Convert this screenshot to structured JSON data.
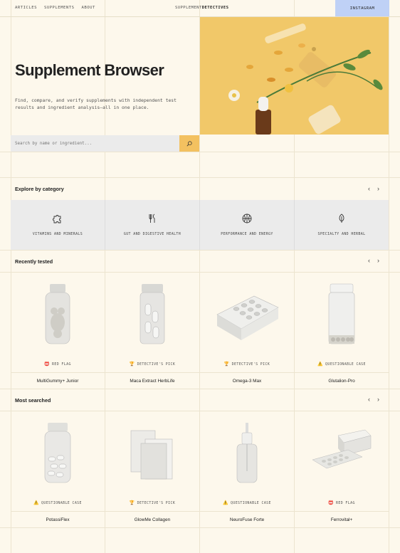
{
  "nav": {
    "links": [
      "ARTICLES",
      "SUPPLEMENTS",
      "ABOUT"
    ],
    "brand_light": "SUPPLEMENT",
    "brand_bold": "DETECTIVES",
    "instagram": "INSTAGRAM"
  },
  "hero": {
    "title": "Supplement Browser",
    "description": "Find, compare, and verify supplements with independent test results and ingredient analysis—all in one place."
  },
  "search": {
    "placeholder": "Search by name or ingredient..."
  },
  "categories": {
    "title": "Explore by category",
    "items": [
      {
        "label": "VITAMINS AND MINERALS",
        "icon": "puzzle-icon"
      },
      {
        "label": "GUT AND DIGESTIVE HEALTH",
        "icon": "fork-knife-icon"
      },
      {
        "label": "PERFORMANCE AND ENERGY",
        "icon": "ball-icon"
      },
      {
        "label": "SPECIALTY AND HERBAL",
        "icon": "leaf-icon"
      }
    ]
  },
  "recent": {
    "title": "Recently tested",
    "items": [
      {
        "badge": "RED FLAG",
        "badge_icon": "📛",
        "name": "MultiGummy+ Junior"
      },
      {
        "badge": "DETECTIVE'S PICK",
        "badge_icon": "🏆",
        "name": "Maca Extract HerbLife"
      },
      {
        "badge": "DETECTIVE'S PICK",
        "badge_icon": "🏆",
        "name": "Omega-3 Max"
      },
      {
        "badge": "QUESTIONABLE CASE",
        "badge_icon": "⚠️",
        "name": "Glutalion-Pro"
      }
    ]
  },
  "most": {
    "title": "Most searched",
    "items": [
      {
        "badge": "QUESTIONABLE CASE",
        "badge_icon": "⚠️",
        "name": "PotassiFlex"
      },
      {
        "badge": "DETECTIVE'S PICK",
        "badge_icon": "🏆",
        "name": "GlowMe Collagen"
      },
      {
        "badge": "QUESTIONABLE CASE",
        "badge_icon": "⚠️",
        "name": "NeuroFuse Forte"
      },
      {
        "badge": "RED FLAG",
        "badge_icon": "📛",
        "name": "Ferrovital+"
      }
    ]
  },
  "colors": {
    "background": "#fdf8ec",
    "accent_yellow": "#f3c160",
    "accent_blue": "#bfd1f6",
    "panel_grey": "#ebebeb"
  }
}
